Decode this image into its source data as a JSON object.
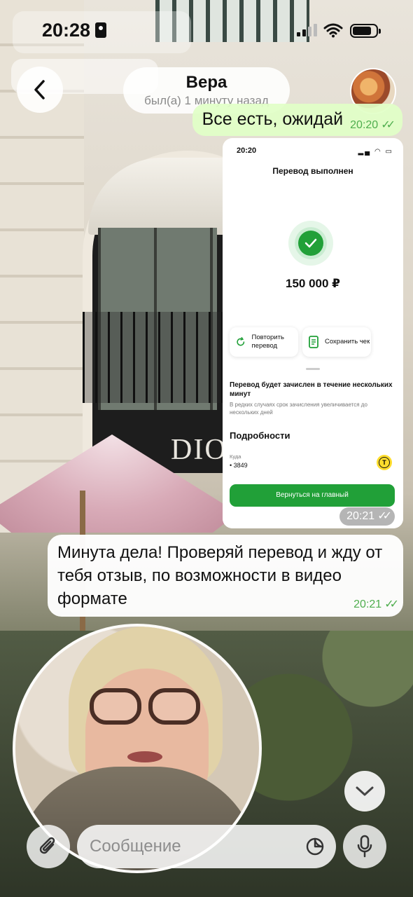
{
  "status_bar": {
    "time": "20:28"
  },
  "header": {
    "contact_name": "Вера",
    "contact_status": "был(а) 1 минуту назад"
  },
  "messages": {
    "out_short": {
      "text": "Все есть, ожидай",
      "time": "20:20"
    },
    "photo": {
      "time": "20:21",
      "screenshot": {
        "status_time": "20:20",
        "title": "Перевод выполнен",
        "amount": "150 000 ₽",
        "repeat_label": "Повторить перевод",
        "save_label": "Сохранить чек",
        "note": "Перевод будет зачислен в течение нескольких минут",
        "note_sub": "В редких случаях срок зачисления увеличивается до нескольких дней",
        "details_title": "Подробности",
        "where_label": "Куда",
        "card": "• 3849",
        "home_button": "Вернуться на главный"
      }
    },
    "out_long": {
      "text": "Минута дела! Проверяй перевод и жду от тебя отзыв, по возможности в видео формате",
      "time": "20:21"
    }
  },
  "composer": {
    "placeholder": "Сообщение"
  },
  "colors": {
    "outgoing_bubble": "#e1ffc7",
    "time_green": "#4fae4e",
    "bank_green": "#21a038"
  },
  "icons": [
    "back-icon",
    "lock-icon",
    "signal-icon",
    "wifi-icon",
    "battery-icon",
    "checkmark-icon",
    "repeat-icon",
    "receipt-icon",
    "chevron-down-icon",
    "paperclip-icon",
    "sticker-icon",
    "microphone-icon"
  ]
}
